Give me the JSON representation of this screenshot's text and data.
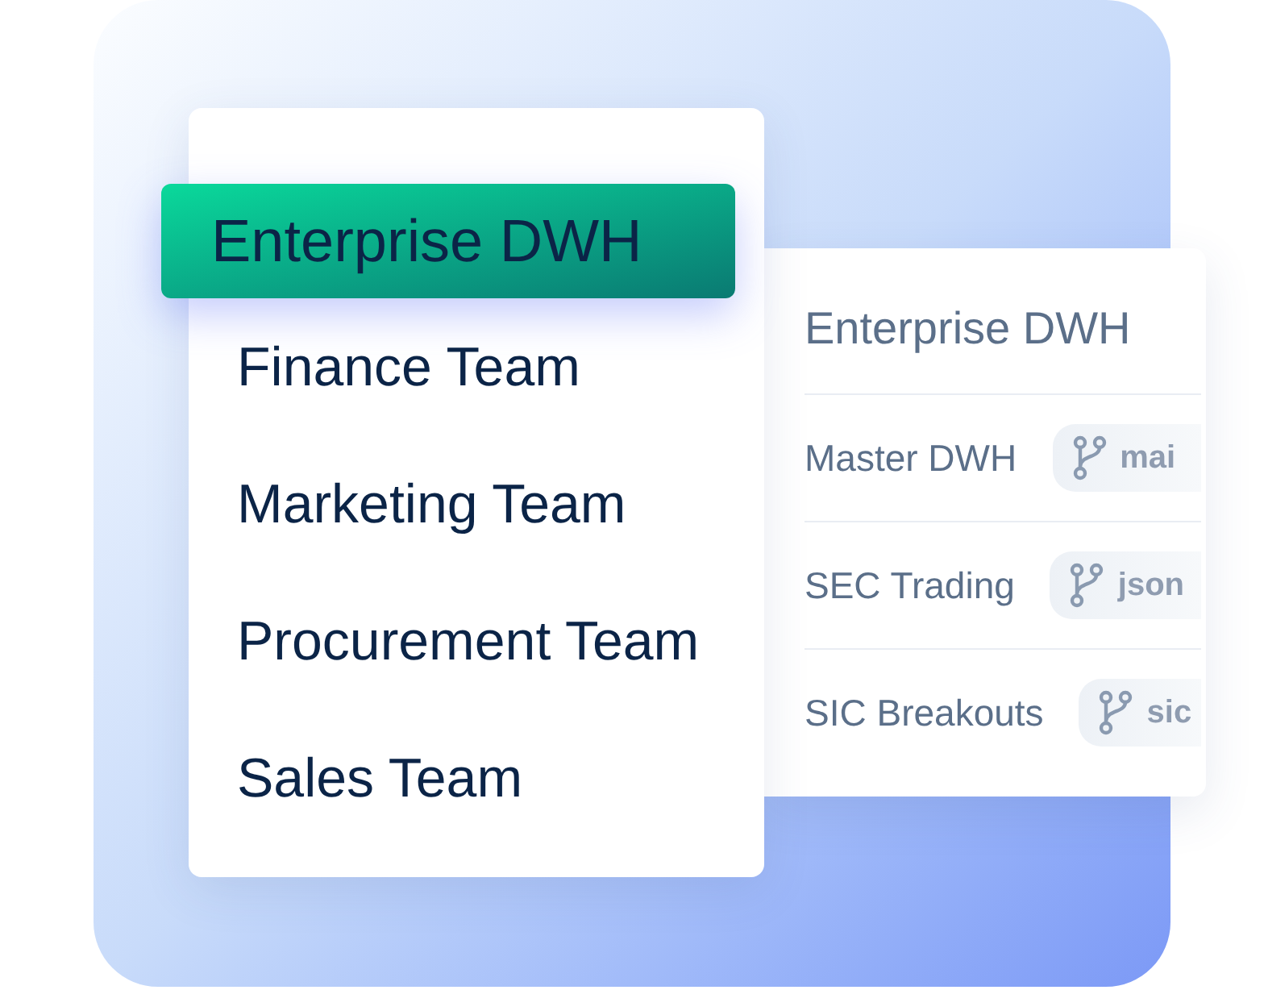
{
  "team_menu": {
    "items": [
      {
        "label": "Enterprise DWH",
        "selected": true
      },
      {
        "label": "Finance Team",
        "selected": false
      },
      {
        "label": "Marketing Team",
        "selected": false
      },
      {
        "label": "Procurement Team",
        "selected": false
      },
      {
        "label": "Sales Team",
        "selected": false
      }
    ]
  },
  "project_panel": {
    "title": "Enterprise DWH",
    "rows": [
      {
        "name": "Master DWH",
        "branch": "mai"
      },
      {
        "name": "SEC Trading",
        "branch": "json"
      },
      {
        "name": "SIC Breakouts",
        "branch": "sic"
      }
    ]
  }
}
